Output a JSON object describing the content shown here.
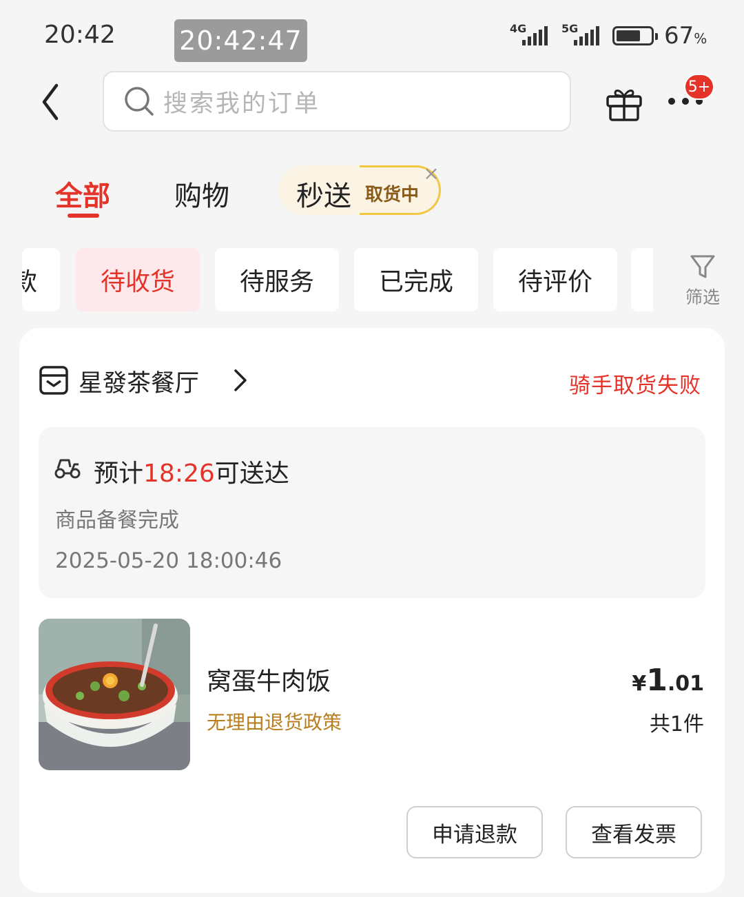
{
  "status_bar": {
    "clock": "20:42",
    "overlay_time": "20:42:47",
    "net1": "4G",
    "net2": "5G",
    "battery_level": 0.67,
    "battery_pct": "67",
    "battery_unit": "%"
  },
  "nav": {
    "search_placeholder": "搜索我的订单",
    "badge": "5+",
    "icons": [
      "back-chevron-icon",
      "search-icon",
      "gift-icon",
      "more-dots-icon"
    ]
  },
  "tabs": {
    "all": "全部",
    "shopping": "购物",
    "flash": "秒送",
    "flash_status": "取货中"
  },
  "chips": {
    "partial": "款",
    "items": [
      "待收货",
      "待服务",
      "已完成",
      "待评价"
    ],
    "active_index": 0,
    "filter_label": "筛选"
  },
  "order": {
    "shop_name": "星發茶餐厅",
    "status": "骑手取货失败",
    "eta_prefix": "预计",
    "eta_time": "18:26",
    "eta_suffix": "可送达",
    "progress_text": "商品备餐完成",
    "timestamp": "2025-05-20  18:00:46",
    "item_name": "窝蛋牛肉饭",
    "item_tag": "无理由退货政策",
    "price_currency": "¥",
    "price_int": "1",
    "price_dec": ".01",
    "quantity": "共1件",
    "btn_refund": "申请退款",
    "btn_invoice": "查看发票"
  },
  "colors": {
    "accent": "#e4342a",
    "gold": "#b97e1d",
    "pill_border": "#f2c744"
  }
}
